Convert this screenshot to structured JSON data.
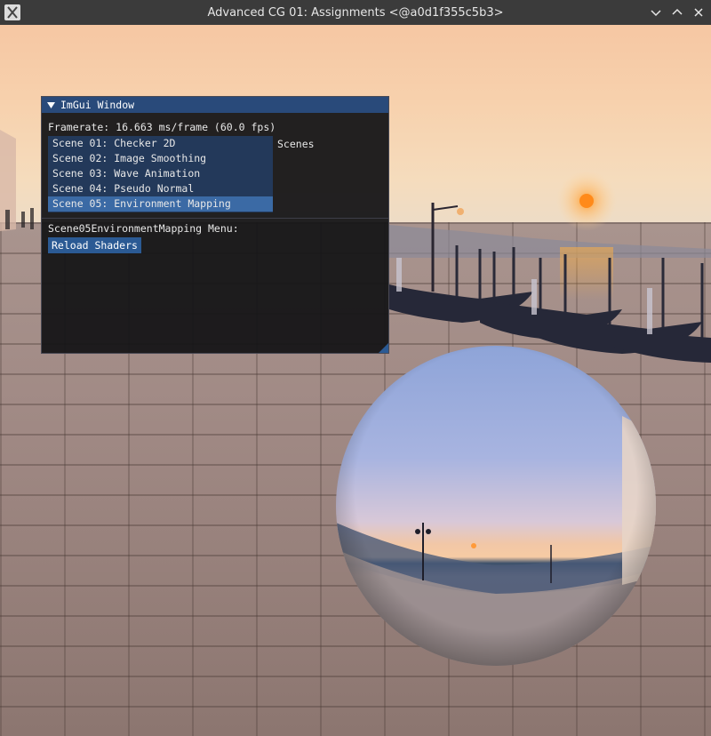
{
  "window": {
    "title": "Advanced CG 01: Assignments <@a0d1f355c5b3>",
    "app_icon": "x-app-icon",
    "controls": [
      "minimize-icon",
      "maximize-icon",
      "close-icon"
    ]
  },
  "imgui": {
    "title": "ImGui Window",
    "framerate": "Framerate: 16.663 ms/frame (60.0 fps)",
    "scenes_label": "Scenes",
    "scenes": [
      "Scene 01: Checker 2D",
      "Scene 02: Image Smoothing",
      "Scene 03: Wave Animation",
      "Scene 04: Pseudo Normal",
      "Scene 05: Environment Mapping"
    ],
    "selected_scene": "Scene 05: Environment Mapping",
    "menu_label": "Scene05EnvironmentMapping Menu:",
    "reload_label": "Reload Shaders"
  },
  "colors": {
    "titlebar": "#3b3b3b",
    "imgui_title": "#294a7a",
    "list_bg": "#23395a",
    "selected": "#3b6aa5",
    "button": "#2b5a94"
  }
}
